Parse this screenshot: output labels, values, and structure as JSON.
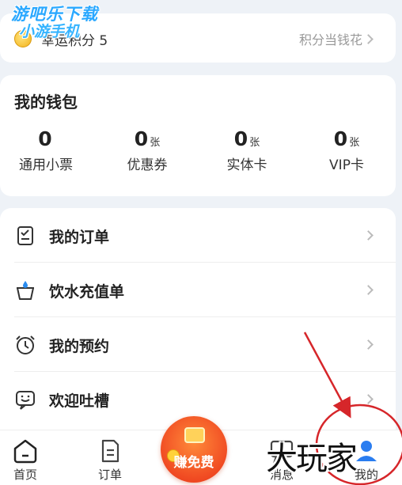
{
  "watermark": {
    "line1": "游吧乐下载",
    "line2": "小游手机"
  },
  "points": {
    "label": "幸运积分",
    "value": "5",
    "link": "积分当钱花"
  },
  "wallet": {
    "title": "我的钱包",
    "items": [
      {
        "value": "0",
        "unit": "",
        "label": "通用小票"
      },
      {
        "value": "0",
        "unit": "张",
        "label": "优惠券"
      },
      {
        "value": "0",
        "unit": "张",
        "label": "实体卡"
      },
      {
        "value": "0",
        "unit": "张",
        "label": "VIP卡"
      }
    ]
  },
  "menu": [
    {
      "label": "我的订单",
      "icon": "order-icon"
    },
    {
      "label": "饮水充值单",
      "icon": "water-cup-icon"
    },
    {
      "label": "我的预约",
      "icon": "alarm-clock-icon"
    },
    {
      "label": "欢迎吐槽",
      "icon": "feedback-icon"
    }
  ],
  "tabbar": {
    "tabs": [
      {
        "label": "首页",
        "icon": "home-icon"
      },
      {
        "label": "订单",
        "icon": "order-doc-icon"
      },
      {
        "label": "消息",
        "icon": "message-icon"
      },
      {
        "label": "我的",
        "icon": "profile-icon"
      }
    ],
    "center_label": "赚免费"
  },
  "overlay_text": "大玩家",
  "colors": {
    "annotation_red": "#d6262a",
    "accent": "#f04a22",
    "watermark": "#2aa8ff"
  }
}
